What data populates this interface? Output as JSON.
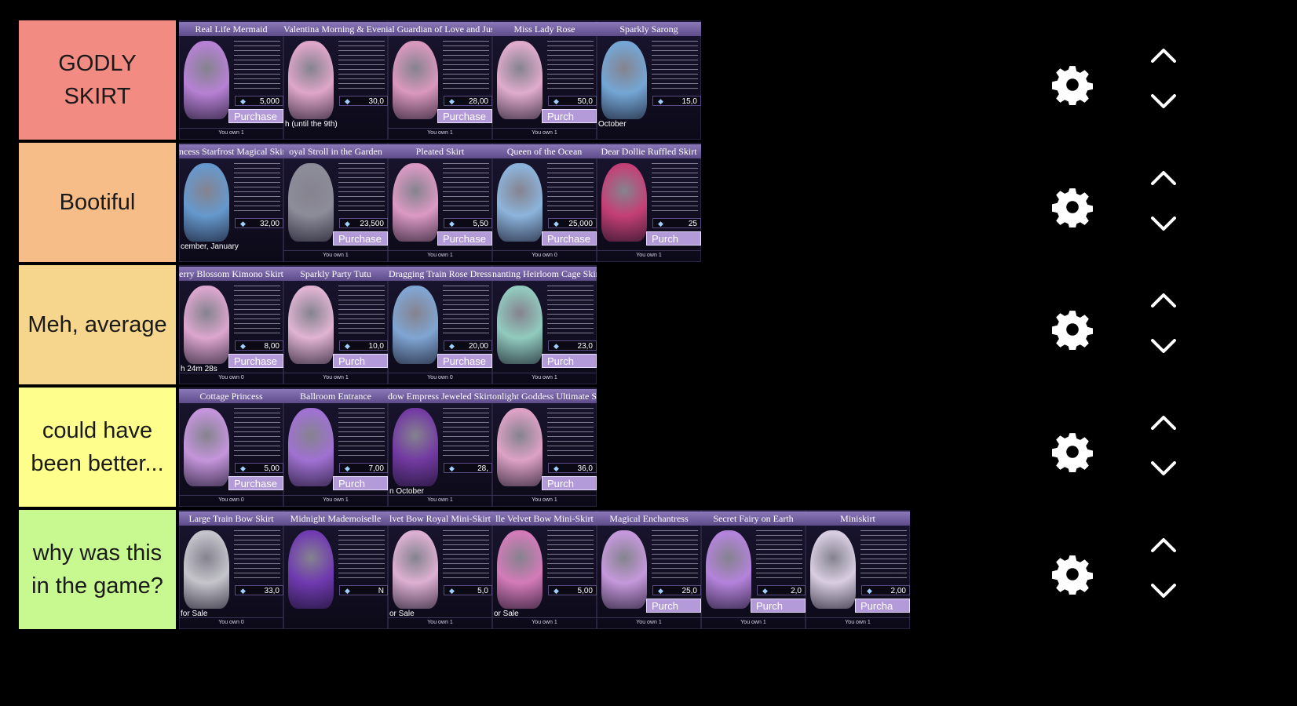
{
  "tiers": [
    {
      "label": "GODLY SKIRT",
      "color": "#f28b82",
      "items": [
        {
          "title": "Real Life Mermaid",
          "price": "5,000",
          "buy": "Purchase",
          "owned": "You own 1",
          "color": "#c98ee8"
        },
        {
          "title": "Valentina Morning & Evening",
          "price": "30,0",
          "buy": "",
          "owned": "",
          "note": "h (until the 9th)",
          "color": "#f6b7dc"
        },
        {
          "title": "al Guardian of Love and Justice",
          "price": "28,00",
          "buy": "Purchase",
          "owned": "You own 1",
          "color": "#f0a7cf"
        },
        {
          "title": "Miss Lady Rose",
          "price": "50,0",
          "buy": "Purch",
          "owned": "You own 1",
          "color": "#f7bde0"
        },
        {
          "title": "Sparkly Sarong",
          "price": "15,0",
          "buy": "",
          "owned": "",
          "note": "October",
          "color": "#7fb7e8"
        }
      ]
    },
    {
      "label": "Bootiful",
      "color": "#f7bd89",
      "items": [
        {
          "title": "ncess Starfrost Magical Skirt",
          "price": "32,00",
          "buy": "",
          "owned": "",
          "note": "cember, January",
          "color": "#6fa8e0"
        },
        {
          "title": "oyal Stroll in the Garden",
          "price": "23,500",
          "buy": "Purchase",
          "owned": "You own 1",
          "color": "#9a9aa6"
        },
        {
          "title": "Pleated Skirt",
          "price": "5,50",
          "buy": "Purchase",
          "owned": "You own 1",
          "color": "#f2a9d6"
        },
        {
          "title": "Queen of the Ocean",
          "price": "25,000",
          "buy": "Purchase",
          "owned": "You own 0",
          "color": "#9ac6f0"
        },
        {
          "title": "Dear Dollie Ruffled Skirt",
          "price": "25",
          "buy": "Purch",
          "owned": "You own 1",
          "color": "#d8457e"
        }
      ]
    },
    {
      "label": "Meh, average",
      "color": "#f6d68c",
      "items": [
        {
          "title": "erry Blossom Kimono Skirt",
          "price": "8,00",
          "buy": "Purchase",
          "owned": "You own 0",
          "note": "h 24m 28s",
          "color": "#f3b7e2"
        },
        {
          "title": "Sparkly Party Tutu",
          "price": "10,0",
          "buy": "Purch",
          "owned": "You own 1",
          "color": "#f7c6e6"
        },
        {
          "title": "Dragging Train Rose Dress",
          "price": "20,00",
          "buy": "Purchase",
          "owned": "You own 0",
          "color": "#8cb6e6"
        },
        {
          "title": "nanting Heirloom Cage Skirt",
          "price": "23,0",
          "buy": "Purch",
          "owned": "You own 1",
          "color": "#9fe0cf"
        }
      ]
    },
    {
      "label": "could have been better...",
      "color": "#fefe8c",
      "items": [
        {
          "title": "Cottage Princess",
          "price": "5,00",
          "buy": "Purchase",
          "owned": "You own 0",
          "color": "#d8a4f0"
        },
        {
          "title": "Ballroom Entrance",
          "price": "7,00",
          "buy": "Purch",
          "owned": "You own 1",
          "color": "#b07ce6"
        },
        {
          "title": "dow Empress Jeweled Skirt",
          "price": "28,",
          "buy": "",
          "owned": "You own 1",
          "note": "n October",
          "color": "#7d3fb0"
        },
        {
          "title": "onlight Goddess Ultimate Skirt",
          "price": "36,0",
          "buy": "Purch",
          "owned": "You own 1",
          "color": "#f4b2d8"
        }
      ]
    },
    {
      "label": "why was this in the game?",
      "color": "#c7f990",
      "items": [
        {
          "title": "Large Train Bow Skirt",
          "price": "33,0",
          "buy": "",
          "owned": "You own 0",
          "note": "for Sale",
          "color": "#d9d9de"
        },
        {
          "title": "Midnight Mademoiselle",
          "price": "N",
          "buy": "",
          "owned": "",
          "color": "#7a3fc0"
        },
        {
          "title": "lvet Bow Royal Mini-Skirt",
          "price": "5,0",
          "buy": "",
          "owned": "You own 1",
          "note": "or Sale",
          "color": "#f4c2e6"
        },
        {
          "title": "lle Velvet Bow Mini-Skirt",
          "price": "5,00",
          "buy": "",
          "owned": "You own 1",
          "note": "or Sale",
          "color": "#e987c9"
        },
        {
          "title": "Magical Enchantress",
          "price": "25,0",
          "buy": "Purch",
          "owned": "You own 1",
          "color": "#d9a8f0"
        },
        {
          "title": "Secret Fairy on Earth",
          "price": "2,0",
          "buy": "Purch",
          "owned": "You own 1",
          "color": "#c690f0"
        },
        {
          "title": "Miniskirt",
          "price": "2,00",
          "buy": "Purcha",
          "owned": "You own 1",
          "color": "#efe3f7"
        }
      ]
    }
  ],
  "icons": {
    "settings": "gear-icon",
    "move_up": "chevron-up-icon",
    "move_down": "chevron-down-icon"
  }
}
